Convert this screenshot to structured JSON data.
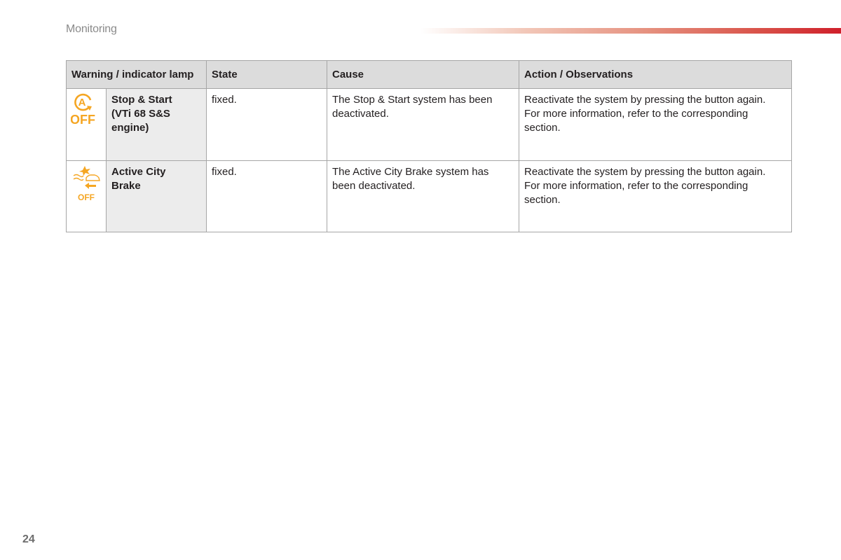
{
  "header": {
    "section_title": "Monitoring",
    "accent_color": "#cf1f2a"
  },
  "table": {
    "columns": [
      "Warning / indicator lamp",
      "State",
      "Cause",
      "Action / Observations"
    ],
    "rows": [
      {
        "icon": "stop-start-off-icon",
        "icon_label": "OFF",
        "icon_letter": "A",
        "name": [
          "Stop & Start",
          "(VTi 68 S&S",
          "engine)"
        ],
        "state": "fixed.",
        "cause": "The Stop & Start system has been deactivated.",
        "action": [
          "Reactivate the system by pressing the button again.",
          "For more information, refer to the corresponding section."
        ]
      },
      {
        "icon": "active-city-brake-off-icon",
        "icon_label": "OFF",
        "name": [
          "Active City",
          "Brake"
        ],
        "state": "fixed.",
        "cause": "The Active City Brake system has been deactivated.",
        "action": [
          "Reactivate the system by pressing the button again.",
          "For more information, refer to the corresponding section."
        ]
      }
    ],
    "icon_color": "#f5a623"
  },
  "footer": {
    "page_number": "24"
  }
}
